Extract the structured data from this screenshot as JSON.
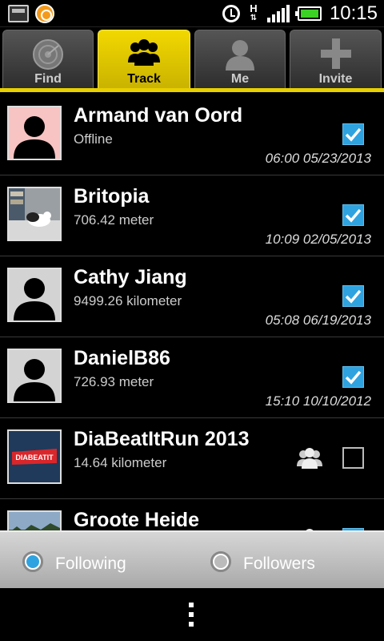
{
  "status_bar": {
    "time": "10:15",
    "network_type": "H",
    "icons": [
      "notification-icon",
      "app-icon",
      "alarm-icon",
      "data-arrows-icon",
      "signal-icon",
      "battery-icon"
    ],
    "battery_color": "#3cd125"
  },
  "tabs": [
    {
      "label": "Find",
      "icon": "radar-icon",
      "active": false
    },
    {
      "label": "Track",
      "icon": "group-icon",
      "active": true
    },
    {
      "label": "Me",
      "icon": "person-icon",
      "active": false
    },
    {
      "label": "Invite",
      "icon": "plus-icon",
      "active": false
    }
  ],
  "colors": {
    "accent": "#e8d000",
    "check_blue": "#2fa3e0",
    "radio_blue": "#2fa3e0"
  },
  "contacts": [
    {
      "name": "Armand van Oord",
      "detail": "Offline",
      "timestamp": "06:00 05/23/2013",
      "checked": true,
      "avatar": "default-avatar-pink"
    },
    {
      "name": "Britopia",
      "detail": "706.42 meter",
      "timestamp": "10:09 02/05/2013",
      "checked": true,
      "avatar": "cat-photo"
    },
    {
      "name": "Cathy Jiang",
      "detail": "9499.26 kilometer",
      "timestamp": "05:08 06/19/2013",
      "checked": true,
      "avatar": "default-avatar"
    },
    {
      "name": "DanielB86",
      "detail": "726.93 meter",
      "timestamp": "15:10 10/10/2012",
      "checked": true,
      "avatar": "default-avatar"
    },
    {
      "name": "DiaBeatItRun 2013",
      "detail": "14.64 kilometer",
      "timestamp": "",
      "checked": false,
      "avatar": "diabeatit-logo",
      "group": true
    },
    {
      "name": "Groote Heide",
      "detail": "",
      "timestamp": "",
      "checked": true,
      "avatar": "landscape-photo",
      "group": true
    }
  ],
  "filter": {
    "following_label": "Following",
    "followers_label": "Followers",
    "selected": "following"
  },
  "avatar_logo_text": "DIABEATIT"
}
